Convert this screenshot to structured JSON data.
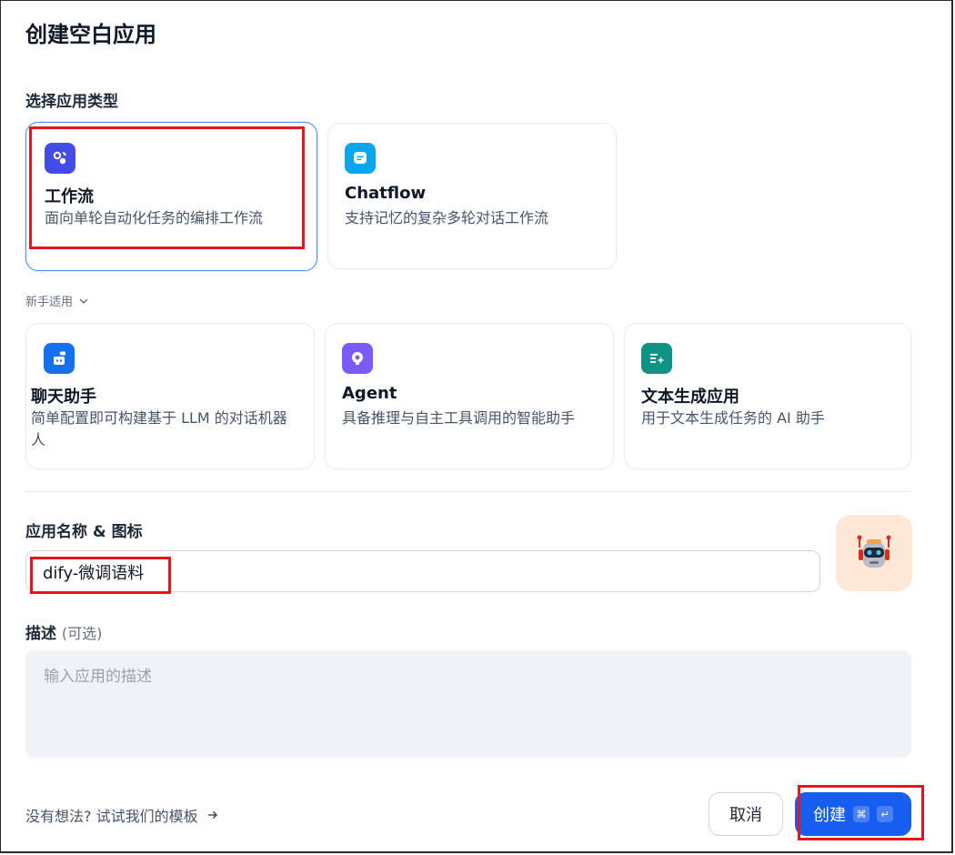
{
  "dialog": {
    "title": "创建空白应用"
  },
  "app_type": {
    "label": "选择应用类型",
    "cards": [
      {
        "title": "工作流",
        "desc": "面向单轮自动化任务的编排工作流",
        "icon": "workflow-icon",
        "color": "#444ce7"
      },
      {
        "title": "Chatflow",
        "desc": "支持记忆的复杂多轮对话工作流",
        "icon": "chatflow-icon",
        "color": "#0ba5ec"
      }
    ]
  },
  "beginner": {
    "label": "新手适用",
    "cards": [
      {
        "title": "聊天助手",
        "desc": "简单配置即可构建基于 LLM 的对话机器人",
        "icon": "chat-assistant-icon",
        "color": "#1570ef"
      },
      {
        "title": "Agent",
        "desc": "具备推理与自主工具调用的智能助手",
        "icon": "agent-icon",
        "color": "#7a5af8"
      },
      {
        "title": "文本生成应用",
        "desc": "用于文本生成任务的 AI 助手",
        "icon": "text-generation-icon",
        "color": "#0e9384"
      }
    ]
  },
  "name_field": {
    "label": "应用名称 & 图标",
    "value": "dify-微调语料"
  },
  "desc_field": {
    "label": "描述",
    "optional": "(可选)",
    "placeholder": "输入应用的描述"
  },
  "footer": {
    "template_link": "没有想法? 试试我们的模板",
    "cancel": "取消",
    "create": "创建",
    "shortcut_cmd": "⌘",
    "shortcut_enter": "↵"
  },
  "colors": {
    "accent": "#155eef",
    "highlight": "#e5161f",
    "selected_border": "#528bff"
  }
}
